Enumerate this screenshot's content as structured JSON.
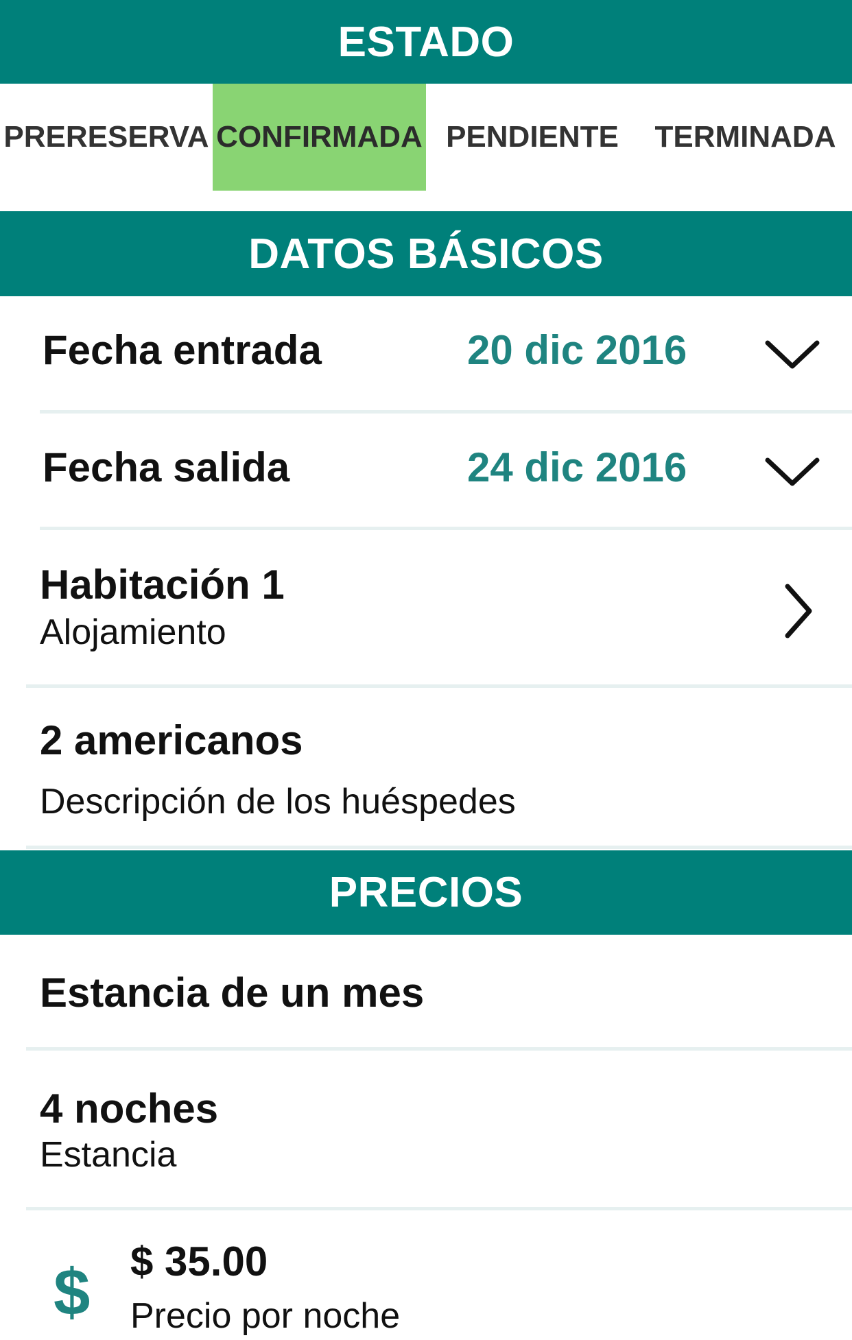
{
  "estado": {
    "header": "ESTADO",
    "tabs": [
      {
        "label": "PRERESERVA",
        "active": false
      },
      {
        "label": "CONFIRMADA",
        "active": true
      },
      {
        "label": "PENDIENTE",
        "active": false
      },
      {
        "label": "TERMINADA",
        "active": false
      }
    ]
  },
  "datos_basicos": {
    "header": "DATOS BÁSICOS",
    "fecha_entrada": {
      "label": "Fecha entrada",
      "value": "20 dic 2016",
      "icon": "chevron-down-icon"
    },
    "fecha_salida": {
      "label": "Fecha salida",
      "value": "24 dic 2016",
      "icon": "chevron-down-icon"
    },
    "habitacion": {
      "title": "Habitación 1",
      "subtitle": "Alojamiento",
      "icon": "chevron-right-icon"
    },
    "huespedes": {
      "title": "2 americanos",
      "subtitle": "Descripción de los huéspedes"
    }
  },
  "precios": {
    "header": "PRECIOS",
    "tarifa": {
      "title": "Estancia de un mes"
    },
    "noches": {
      "title": "4 noches",
      "subtitle": "Estancia"
    },
    "precio": {
      "icon_glyph": "$",
      "icon": "dollar-icon",
      "amount": "$ 35.00",
      "label": "Precio por noche"
    }
  },
  "colors": {
    "header_bg": "#00807a",
    "active_tab_bg": "#89d473",
    "accent_text": "#1f8480"
  }
}
